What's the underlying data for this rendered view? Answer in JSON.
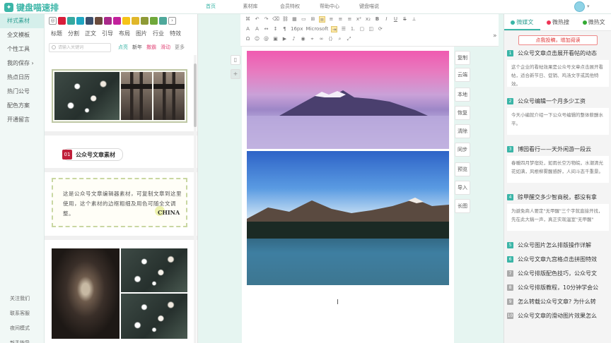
{
  "app": {
    "logo_text": "键盘喵速排"
  },
  "topnav": [
    "首页",
    "素材库",
    "会员特权",
    "帮助中心",
    "键盘喵说"
  ],
  "leftnav": {
    "items": [
      "样式素材",
      "全文模板",
      "个性工具",
      "我的保存",
      "热点日历",
      "热门公号",
      "配色方案",
      "开通留言"
    ],
    "bottom": [
      "关注我们",
      "联系客服",
      "夜间模式",
      "新手指导"
    ]
  },
  "swatch_colors": [
    "#d81e3a",
    "#34a8a0",
    "#1fa6c2",
    "#3d4f6b",
    "#6a4b3c",
    "#a92a8a",
    "#c2219c",
    "#f6c317",
    "#e0b72a",
    "#8e9a36",
    "#6fa83a",
    "#4ea89b"
  ],
  "panel": {
    "cats": [
      "标题",
      "分割",
      "正文",
      "引导",
      "布局",
      "图片",
      "行业",
      "特效"
    ],
    "search_placeholder": "请输入关键词",
    "tags": [
      {
        "label": "点亮",
        "color": "#3bb5a7"
      },
      {
        "label": "新年",
        "color": "#555"
      },
      {
        "label": "撒霸",
        "color": "#e24a7a"
      },
      {
        "label": "滑动",
        "color": "#e24a7a"
      },
      {
        "label": "更多",
        "color": "#888"
      }
    ],
    "badge_num": "01",
    "badge_text": "公众号文章素材",
    "quote_text": "这是公众号文章编辑器素材，可复制文章到这里使用，这个素材的边框粗细及用色可随全文调整。",
    "quote_sign": "CHINA"
  },
  "toolbar": {
    "font_size": "16px",
    "font_family": "Microsoft"
  },
  "side_buttons": [
    "复制",
    "云端",
    "本地",
    "恢复",
    "清除",
    "同步",
    "预览",
    "导入",
    "长图"
  ],
  "right": {
    "tabs": [
      "微媒文",
      "微热搜",
      "微热文"
    ],
    "promo": "点我投稿，增加阅读",
    "items": [
      {
        "n": "1",
        "title": "公众号文章点击展开看帖的动态",
        "desc": "这个企业的看帖效果是公众号文章点击展开看帖，适合新节日、促销、鸡汤文字或其他特效。",
        "color": "#3bb5a7"
      },
      {
        "n": "2",
        "title": "公众号编辑一个月多少工资",
        "desc": "今天小编就介绍一下公众号编辑的整体薪酬水平。",
        "color": "#3bb5a7"
      },
      {
        "n": "3",
        "title": "博园看行——天外闲游一段云",
        "desc": "春暖四月梦宿处，如雨长空万物皖，水潮清光花如满，风根柳雾醒感醉，人间斗态千重景。",
        "color": "#3bb5a7"
      },
      {
        "n": "4",
        "title": "赊甲醒交多少智商税，都没有拿",
        "desc": "为避免商人要定\"无甲醒\"三个字就直接开找，先在此大稿一声，真正实现温室\"无甲醒\"",
        "color": "#3bb5a7"
      },
      {
        "n": "5",
        "title": "公众号图片怎么排版操作详解",
        "color": "#3bb5a7"
      },
      {
        "n": "6",
        "title": "公众号文章九宫格点击拼图特效",
        "color": "#3bb5a7"
      },
      {
        "n": "7",
        "title": "公众号排版配色技巧，公众号文",
        "color": "#aaa"
      },
      {
        "n": "8",
        "title": "公众号排版教程，10分钟学会公",
        "color": "#aaa"
      },
      {
        "n": "9",
        "title": "怎么转载公众号文章? 为什么转",
        "color": "#aaa"
      },
      {
        "n": "10",
        "title": "公众号文章的滑动图片效果怎么",
        "color": "#aaa"
      }
    ]
  }
}
